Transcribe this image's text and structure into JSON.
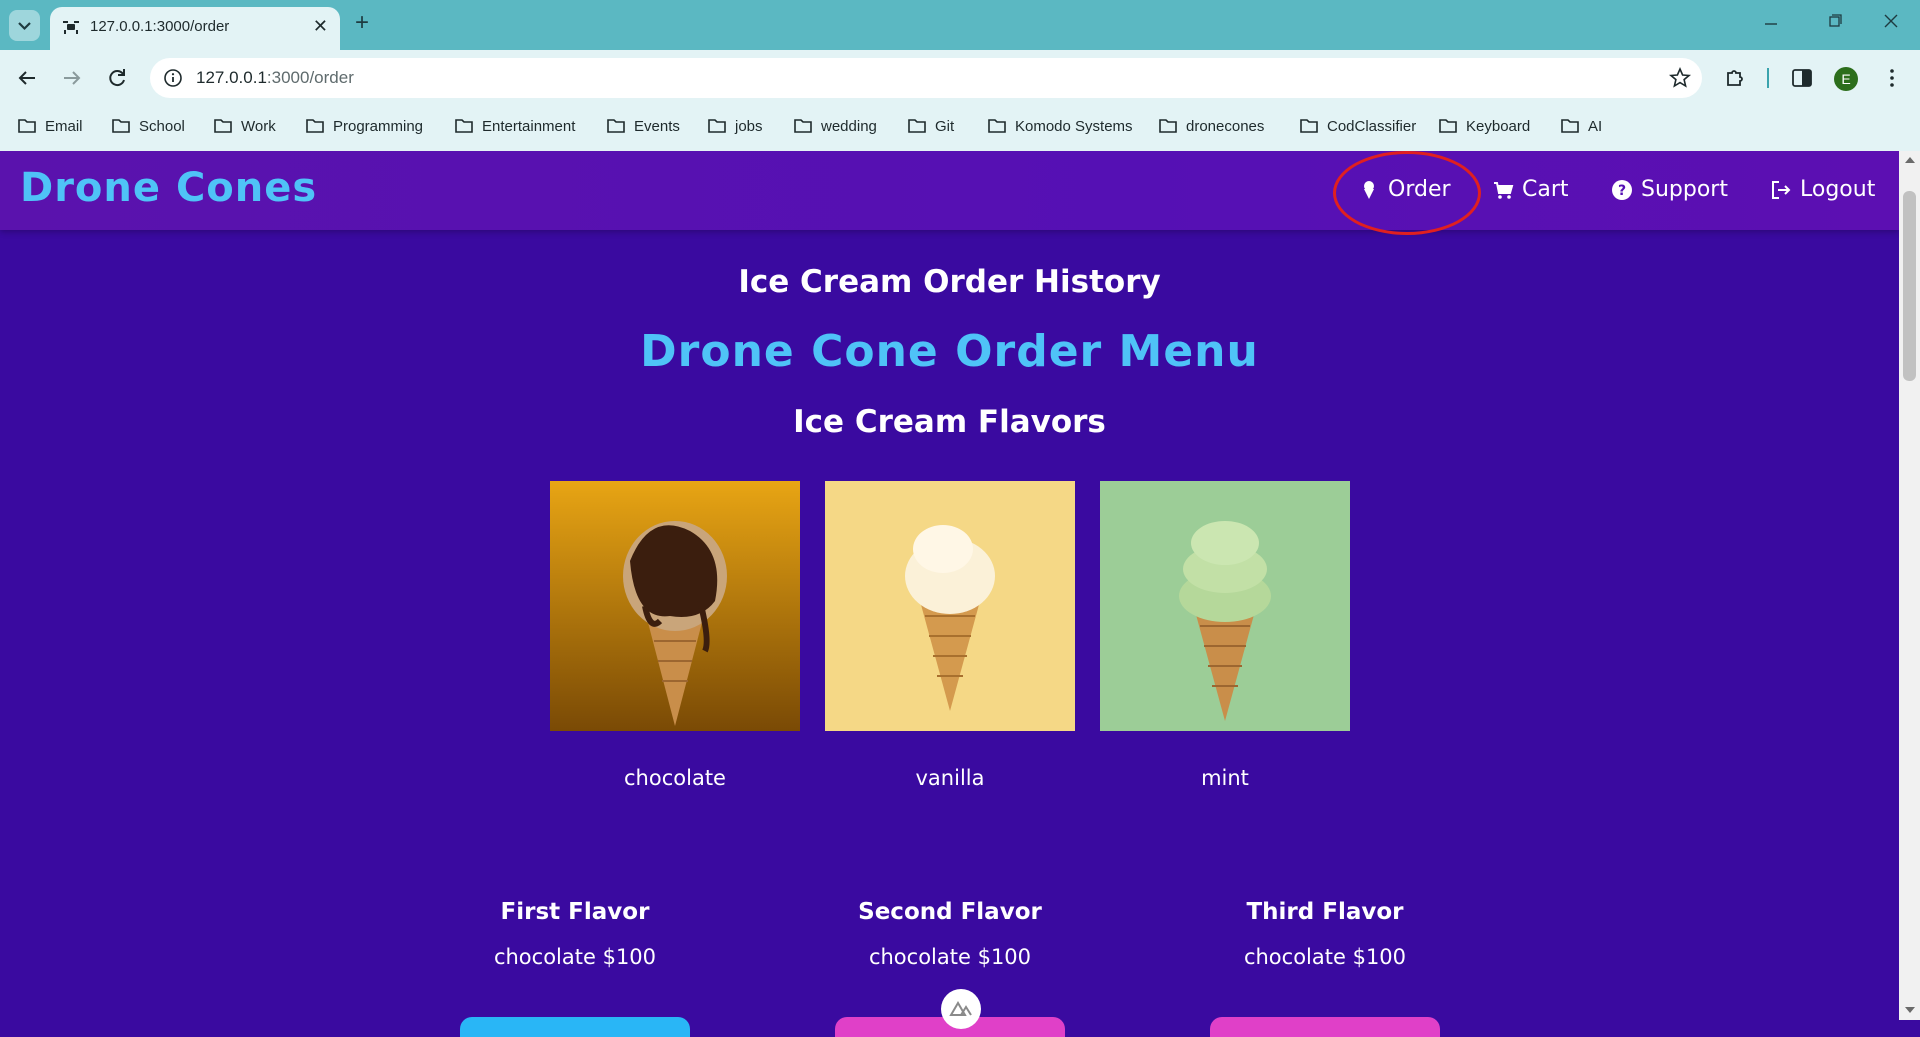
{
  "browser": {
    "tab_title": "127.0.0.1:3000/order",
    "url_host": "127.0.0.1",
    "url_path": ":3000/order",
    "profile_initial": "E",
    "bookmarks": [
      "Email",
      "School",
      "Work",
      "Programming",
      "Entertainment",
      "Events",
      "jobs",
      "wedding",
      "Git",
      "Komodo Systems",
      "dronecones",
      "CodClassifier",
      "Keyboard",
      "AI"
    ]
  },
  "navbar": {
    "brand": "Drone Cones",
    "links": {
      "order": "Order",
      "cart": "Cart",
      "support": "Support",
      "logout": "Logout"
    }
  },
  "page": {
    "history_heading": "Ice Cream Order History",
    "menu_heading": "Drone Cone Order Menu",
    "flavors_heading": "Ice Cream Flavors",
    "flavors": [
      {
        "name": "chocolate",
        "bg": "#d99410"
      },
      {
        "name": "vanilla",
        "bg": "#f5d886"
      },
      {
        "name": "mint",
        "bg": "#9ccd97"
      }
    ],
    "choices": [
      {
        "title": "First Flavor",
        "value": "chocolate $100"
      },
      {
        "title": "Second Flavor",
        "value": "chocolate $100"
      },
      {
        "title": "Third Flavor",
        "value": "chocolate $100"
      }
    ]
  },
  "colors": {
    "page_bg": "#3a0aa0",
    "navbar_bg": "#5510b4",
    "accent": "#4fc3f7",
    "annotation_ring": "#e02020"
  }
}
